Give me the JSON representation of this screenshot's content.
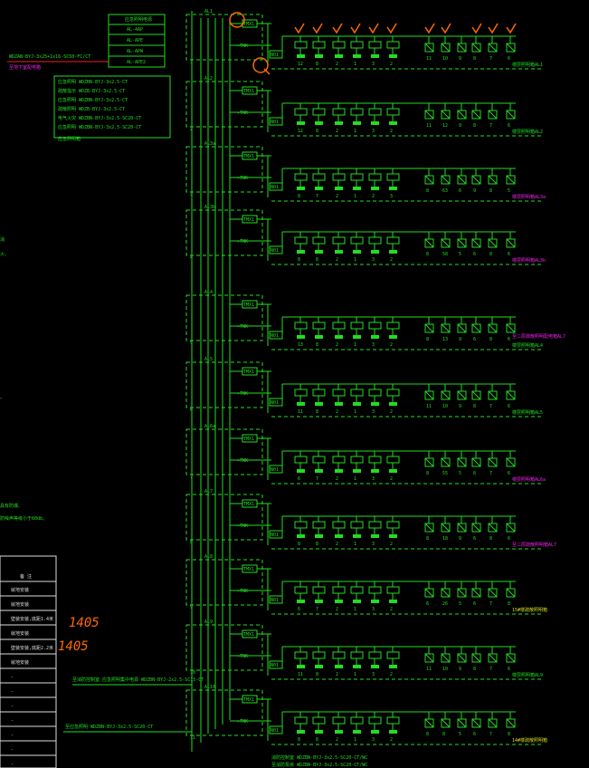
{
  "left_box": {
    "rows": [
      "应急照明电源",
      "AL-4AP",
      "AL-APE",
      "AL-APW",
      "AL-APE2"
    ]
  },
  "main_cable": "WDZAN-BYJ-3x25+1x16-SC50-FC/CT",
  "main_cable_sub": "至地下室配电箱",
  "feeder_notes": [
    "应急照明 WDZBN-BYJ-3x2.5-CT",
    "疏散指示 WDZB-BYJ-3x2.5-CT",
    "应急照明 WDZBN-BYJ-3x2.5-CT",
    "疏散照明 WDZB-BYJ-3x2.5-CT",
    "电气火灾 WDZBN-BYJ-3x2.5-SC20-CT",
    "应急照明 WDZBN-BYJ-3x2.5-SC20-CT",
    "应急照明箱"
  ],
  "left_margin_fragments": [
    "消",
    "火、",
    "。",
    "具有防爆、",
    "防噪声等级小于60db。"
  ],
  "spec_table": {
    "header": "备 注",
    "rows": [
      "就地安装",
      "就地安装",
      "壁装安装,底距1.4米",
      "就地安装",
      "壁装安装,底距2.2米",
      "就地安装",
      "-",
      "-",
      "-",
      "-",
      "-",
      "-",
      "-"
    ]
  },
  "handwritten_notes": [
    "1405",
    "1405"
  ],
  "unit_labels": {
    "breaker": "TMX1",
    "feeder": "-TNK",
    "module": "N01"
  },
  "panels": [
    {
      "id": "1",
      "tag": "AL1",
      "dest": "楼层照明箱AL1",
      "dest_color": "green",
      "loads": [
        "12",
        "8",
        "2",
        "1",
        "3",
        "2"
      ],
      "sensors": [
        "11",
        "10",
        "9",
        "8",
        "7",
        "6"
      ]
    },
    {
      "id": "2",
      "tag": "AL2",
      "dest": "楼层照明箱AL2",
      "dest_color": "green",
      "loads": [
        "12",
        "8",
        "2",
        "1",
        "3",
        "2"
      ],
      "sensors": [
        "11",
        "12",
        "9",
        "8",
        "7",
        "6"
      ]
    },
    {
      "id": "3",
      "tag": "AL3a",
      "dest": "楼层照明箱AL3a",
      "dest_color": "magenta",
      "loads": [
        "8",
        "7",
        "2",
        "1",
        "2",
        "3"
      ],
      "sensors": [
        "8",
        "63",
        "6",
        "9",
        "8",
        "5"
      ]
    },
    {
      "id": "4",
      "tag": "AL3b",
      "dest": "楼层照明箱AL3b",
      "dest_color": "magenta",
      "loads": [
        "8",
        "8",
        "2",
        "1",
        "3",
        "2"
      ],
      "sensors": [
        "8",
        "58",
        "5",
        "6",
        "8",
        "6"
      ]
    },
    {
      "id": "5",
      "tag": "AL4",
      "dest": "楼层照明箱AL4",
      "dest_color": "green",
      "loads": [
        "13",
        "8",
        "2",
        "1",
        "3",
        "2"
      ],
      "sensors": [
        "8",
        "13",
        "9",
        "6",
        "8",
        "6"
      ]
    },
    {
      "id": "6",
      "tag": "AL5",
      "dest": "楼层照明箱AL5",
      "dest_color": "green",
      "loads": [
        "11",
        "8",
        "2",
        "1",
        "3",
        "2"
      ],
      "sensors": [
        "11",
        "10",
        "9",
        "8",
        "7",
        "6"
      ]
    },
    {
      "id": "7",
      "tag": "AL6a",
      "dest": "楼层照明箱AL6a",
      "dest_color": "magenta",
      "loads": [
        "6",
        "7",
        "2",
        "1",
        "3",
        "2"
      ],
      "sensors": [
        "8",
        "55",
        "5",
        "6",
        "7",
        "6"
      ]
    },
    {
      "id": "8",
      "tag": "AL7",
      "dest": "至二层疏散照明箱AL7",
      "dest_color": "magenta",
      "loads": [
        "8",
        "8",
        "2",
        "1",
        "3",
        "2"
      ],
      "sensors": [
        "8",
        "18",
        "9",
        "6",
        "8",
        "6"
      ]
    },
    {
      "id": "9",
      "tag": "AL8",
      "dest": "15#楼疏散照明箱",
      "dest_color": "yellow",
      "loads": [
        "6",
        "7",
        "2",
        "1",
        "3",
        "2"
      ],
      "sensors": [
        "6",
        "26",
        "5",
        "6",
        "7",
        "8"
      ]
    },
    {
      "id": "10",
      "tag": "AL9",
      "dest": "楼层照明箱AL9",
      "dest_color": "green",
      "loads": [
        "11",
        "8",
        "2",
        "1",
        "3",
        "2"
      ],
      "sensors": [
        "11",
        "10",
        "9",
        "8",
        "7",
        "6"
      ]
    },
    {
      "id": "11",
      "tag": "AL10",
      "dest": "14#楼疏散照明箱",
      "dest_color": "yellow",
      "loads": [
        "8",
        "8",
        "2",
        "1",
        "3",
        "2"
      ],
      "sensors": [
        "8",
        "8",
        "5",
        "6",
        "7",
        "8"
      ]
    }
  ],
  "middle_dest_note": "至二层疏散照明配电箱AL7",
  "bottom_cables": [
    "消防控制室 WDZBN-BYJ-3x2.5-SC20-CT/WC",
    "至消防泵房 WDZBN-BYJ-3x2.5-SC20-CT/WC"
  ],
  "bottom_left_cables": [
    "至消防控制室 应急照明集中电源 WDZBN-BYJ-2x2.5-SC15-CT",
    "至应急照明 WDZBN-BYJ-3x2.5-SC20-CT"
  ],
  "colors": {
    "line": "#22dd22",
    "magenta": "#ee22ee",
    "yellow": "#dddd22",
    "orange": "#ff6a00",
    "background": "#000000"
  }
}
